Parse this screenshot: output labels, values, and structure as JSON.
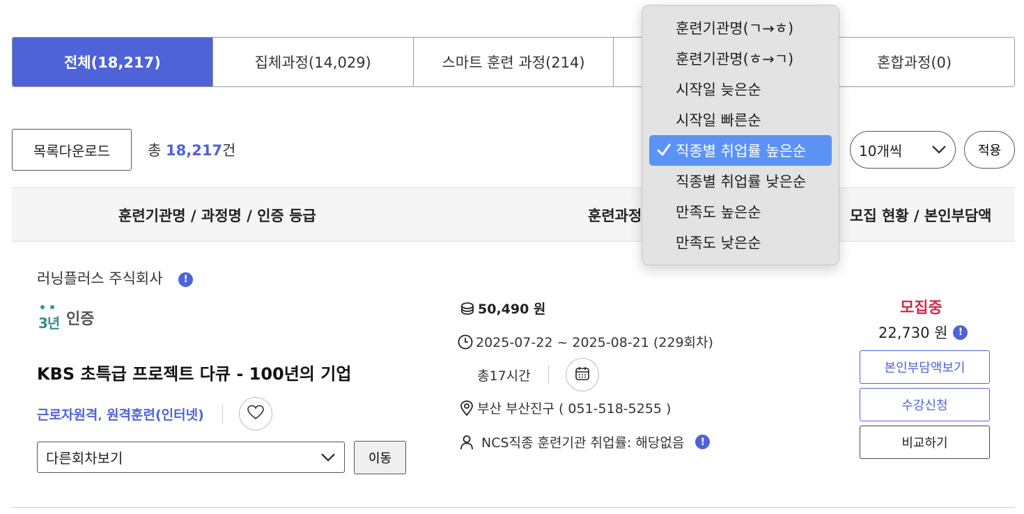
{
  "tabs": [
    {
      "label": "전체(18,217)",
      "active": true
    },
    {
      "label": "집체과정(14,029)",
      "active": false
    },
    {
      "label": "스마트 훈련 과정(214)",
      "active": false
    },
    {
      "label": "",
      "active": false
    },
    {
      "label": "혼합과정(0)",
      "active": false
    }
  ],
  "toolbar": {
    "download_label": "목록다운로드",
    "total_prefix": "총 ",
    "total_count": "18,217",
    "total_suffix": "건",
    "per_page_value": "10개씩",
    "apply_label": "적용"
  },
  "table_header": {
    "col1": "훈련기관명 / 과정명 / 인증 등급",
    "col2": "훈련과정",
    "col3": "모집 현황 / 본인부담액"
  },
  "course": {
    "org_name": "러닝플러스 주식회사",
    "cert_year": "3년",
    "cert_label": "인증",
    "title": "KBS 초특급 프로젝트 다큐 - 100년의 기업",
    "type1": "근로자원격",
    "type_sep": ",",
    "type2": "원격훈련(인터넷)",
    "session_select": "다른회차보기",
    "move_label": "이동",
    "price": "50,490 원",
    "period": "2025-07-22 ~ 2025-08-21 (229회차)",
    "hours": "총17시간",
    "location": "부산 부산진구 ( 051-518-5255 )",
    "employment": "NCS직종 훈련기관 취업률: 해당없음",
    "status": "모집중",
    "self_pay": "22,730 원",
    "buttons": {
      "view_selfpay": "본인부담액보기",
      "apply": "수강신청",
      "compare": "비교하기"
    }
  },
  "sort_menu": {
    "items": [
      {
        "label": "훈련기관명(ㄱ→ㅎ)",
        "selected": false
      },
      {
        "label": "훈련기관명(ㅎ→ㄱ)",
        "selected": false
      },
      {
        "label": "시작일 늦은순",
        "selected": false
      },
      {
        "label": "시작일 빠른순",
        "selected": false
      },
      {
        "label": "직종별 취업률 높은순",
        "selected": true
      },
      {
        "label": "직종별 취업률 낮은순",
        "selected": false
      },
      {
        "label": "만족도 높은순",
        "selected": false
      },
      {
        "label": "만족도 낮은순",
        "selected": false
      }
    ]
  },
  "colors": {
    "accent": "#4e63d8",
    "status_recruiting": "#d32a46",
    "menu_selected": "#5b93f5"
  }
}
